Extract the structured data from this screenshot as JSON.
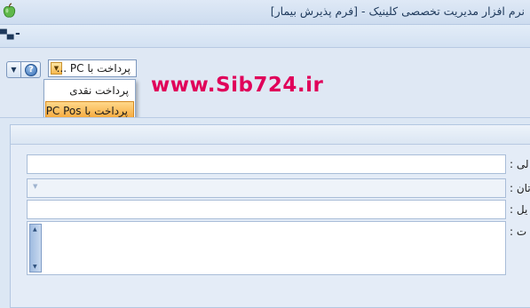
{
  "window": {
    "title": "نرم افزار مدیریت تخصصی کلینیک - [فرم پذیرش بیمار]"
  },
  "menubar": {
    "minimize_label": "-"
  },
  "toolbar": {
    "arrow_glyph": "▼",
    "help_glyph": "?"
  },
  "payment_combo": {
    "selected": "پرداخت با PC ..."
  },
  "payment_dropdown": {
    "options": [
      "پرداخت نقدی",
      "پرداخت با PC Pos"
    ],
    "highlighted_index": 1
  },
  "watermark": "www.Sib724.ir",
  "form": {
    "fields": [
      {
        "label": "لی :",
        "value": ""
      },
      {
        "label": "تان :",
        "value": ""
      },
      {
        "label": "یل :",
        "value": ""
      },
      {
        "label": "ت :",
        "value": ""
      }
    ]
  },
  "colors": {
    "watermark": "#e0005a",
    "highlight": "#f6a73a",
    "border": "#a9bdd8"
  }
}
